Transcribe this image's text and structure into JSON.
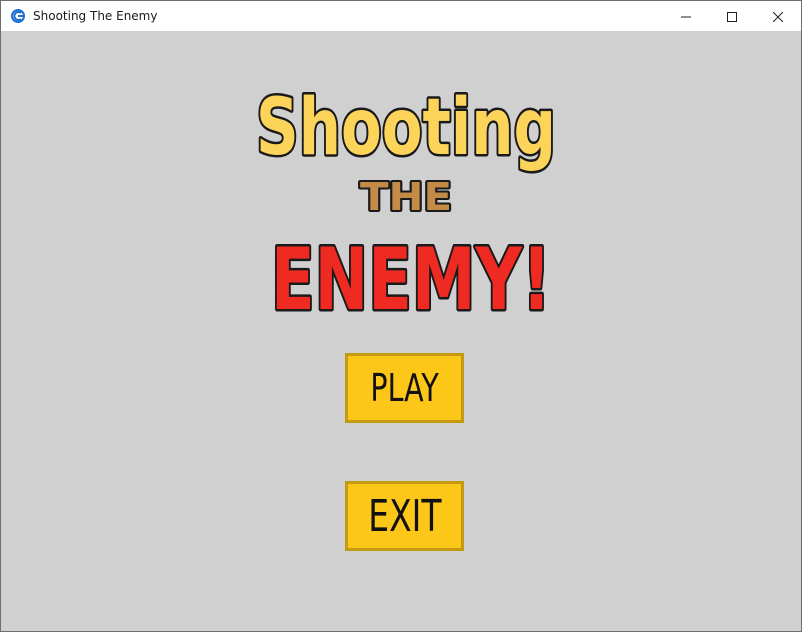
{
  "window": {
    "title": "Shooting The Enemy",
    "controls": [
      "minimize-icon",
      "maximize-icon",
      "close-icon"
    ]
  },
  "logo": {
    "line1": "Shooting",
    "line2": "THE",
    "line3": "ENEMY!",
    "colors": {
      "line1": "#fdd45a",
      "line2": "#c48a47",
      "line3": "#ef2a22",
      "outline": "#1a1a1a"
    }
  },
  "menu": {
    "play_label": "PLAY",
    "exit_label": "EXIT",
    "button_color": "#fcc719",
    "button_border": "#c39a12"
  },
  "background_color": "#d0d0d0"
}
